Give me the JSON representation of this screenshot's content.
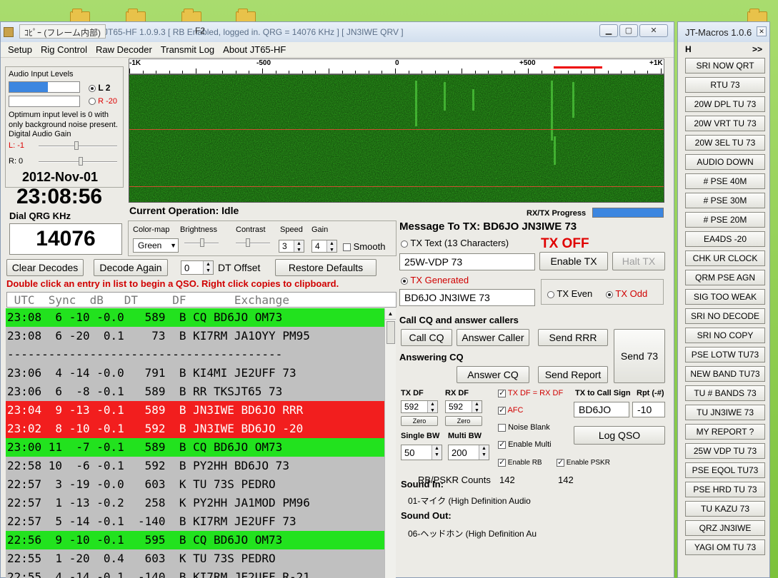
{
  "window": {
    "title": "JT65-HF 1.0.9.3  [ RB Enabled, logged in.  QRG = 14076 KHz ] [ JN3IWE QRV ]",
    "overlay_tab": "ｺﾋﾟｰ (フレーム内部)",
    "f2": "F2"
  },
  "menu": [
    "Setup",
    "Rig Control",
    "Raw Decoder",
    "Transmit Log",
    "About JT65-HF"
  ],
  "audio": {
    "label": "Audio Input Levels",
    "l_label": "L 2",
    "r_label": "R -20",
    "hint": "Optimum input level is 0 with only background noise present.",
    "gain_label": "Digital Audio Gain",
    "gain_l": "L: -1",
    "gain_r": "R: 0",
    "level_fraction_l": 0.55
  },
  "clock": {
    "date": "2012-Nov-01",
    "time": "23:08:56",
    "qrg_label": "Dial QRG KHz",
    "qrg": "14076"
  },
  "ruler": {
    "labels": [
      "-1K",
      "-500",
      "0",
      "+500",
      "+1K"
    ]
  },
  "operation": {
    "label": "Current Operation:",
    "value": "Idle"
  },
  "progress": {
    "label": "RX/TX Progress"
  },
  "controls": {
    "colormap_label": "Color-map",
    "colormap": "Green",
    "brightness_label": "Brightness",
    "contrast_label": "Contrast",
    "speed_label": "Speed",
    "speed": "3",
    "gain_label": "Gain",
    "gain": "4",
    "smooth_label": "Smooth"
  },
  "buttons": {
    "clear": "Clear Decodes",
    "decode_again": "Decode Again",
    "dt_value": "0",
    "dt_label": "DT Offset",
    "restore": "Restore Defaults"
  },
  "hint_red": "Double click an entry in list to begin a QSO.  Right click copies to clipboard.",
  "list_header": " UTC  Sync  dB   DT     DF       Exchange",
  "decodes": [
    {
      "text": "23:08  6 -10 -0.0   589  B CQ BD6JO OM73",
      "kind": "green"
    },
    {
      "text": "23:08  6 -20  0.1    73  B KI7RM JA1OYY PM95",
      "kind": ""
    },
    {
      "text": "----------------------------------------",
      "kind": "sep"
    },
    {
      "text": "23:06  4 -14 -0.0   791  B KI4MI JE2UFF 73",
      "kind": ""
    },
    {
      "text": "23:06  6  -8 -0.1   589  B RR TKSJT65 73",
      "kind": ""
    },
    {
      "text": "23:04  9 -13 -0.1   589  B JN3IWE BD6JO RRR",
      "kind": "red"
    },
    {
      "text": "23:02  8 -10 -0.1   592  B JN3IWE BD6JO -20",
      "kind": "red"
    },
    {
      "text": "23:00 11  -7 -0.1   589  B CQ BD6JO OM73",
      "kind": "green"
    },
    {
      "text": "22:58 10  -6 -0.1   592  B PY2HH BD6JO 73",
      "kind": ""
    },
    {
      "text": "22:57  3 -19 -0.0   603  K TU 73S PEDRO",
      "kind": ""
    },
    {
      "text": "22:57  1 -13 -0.2   258  K PY2HH JA1MOD PM96",
      "kind": ""
    },
    {
      "text": "22:57  5 -14 -0.1  -140  B KI7RM JE2UFF 73",
      "kind": ""
    },
    {
      "text": "22:56  9 -10 -0.1   595  B CQ BD6JO OM73",
      "kind": "green"
    },
    {
      "text": "22:55  1 -20  0.4   603  K TU 73S PEDRO",
      "kind": ""
    },
    {
      "text": "22:55  4 -14 -0.1  -140  B KI7RM JE2UFF R-21",
      "kind": ""
    }
  ],
  "tx": {
    "message_label": "Message To TX: BD6JO JN3IWE 73",
    "tx_text_label": "TX Text (13 Characters)",
    "tx_off": "TX OFF",
    "tx_text_value": "25W-VDP 73",
    "enable_tx": "Enable TX",
    "halt_tx": "Halt TX",
    "tx_generated_label": "TX Generated",
    "tx_generated_value": "BD6JO JN3IWE 73",
    "tx_even": "TX Even",
    "tx_odd": "TX Odd"
  },
  "qso": {
    "cq_label": "Call CQ and answer callers",
    "call_cq": "Call CQ",
    "answer_caller": "Answer Caller",
    "send_rrr": "Send RRR",
    "send_73": "Send 73",
    "answering_label": "Answering CQ",
    "answer_cq": "Answer CQ",
    "send_report": "Send Report"
  },
  "df": {
    "tx_df_label": "TX DF",
    "tx_df": "592",
    "rx_df_label": "RX DF",
    "rx_df": "592",
    "zero": "Zero",
    "single_bw_label": "Single BW",
    "single_bw": "50",
    "multi_bw_label": "Multi BW",
    "multi_bw": "200",
    "txdf_eq_rxdf": "TX DF = RX DF",
    "afc": "AFC",
    "noise_blank": "Noise Blank",
    "enable_multi": "Enable Multi",
    "enable_rb": "Enable RB",
    "enable_pskr": "Enable PSKR",
    "tx_call_label": "TX to Call Sign",
    "tx_call": "BD6JO",
    "rpt_label": "Rpt (-#)",
    "rpt": "-10",
    "log_qso": "Log QSO",
    "counts_label": "RB/PSKR Counts",
    "count_rb": "142",
    "count_pskr": "142"
  },
  "sound": {
    "in_label": "Sound In:",
    "in_value": "01-マイク (High Definition Audio",
    "out_label": "Sound Out:",
    "out_value": "06-ヘッドホン (High Definition Au"
  },
  "macros": {
    "title": "JT-Macros 1.0.6",
    "h": "H",
    "more": ">>",
    "items": [
      "SRI NOW QRT",
      "RTU 73",
      "20W DPL TU 73",
      "20W VRT TU 73",
      "20W 3EL TU 73",
      "AUDIO DOWN",
      "# PSE 40M",
      "# PSE 30M",
      "# PSE 20M",
      "EA4DS -20",
      "CHK UR CLOCK",
      "QRM PSE AGN",
      "SIG TOO WEAK",
      "SRI NO DECODE",
      "SRI NO COPY",
      "PSE LOTW TU73",
      "NEW BAND TU73",
      "TU # BANDS 73",
      "TU JN3IWE 73",
      "MY REPORT ?",
      "25W VDP TU 73",
      "PSE EQOL TU73",
      "PSE HRD TU 73",
      "TU KAZU 73",
      "QRZ JN3IWE",
      "YAGI OM TU 73"
    ]
  },
  "colors": {
    "green_row": "#22e21e",
    "red_row": "#f21e1e",
    "tx_off": "#e00000",
    "hint": "#d00000"
  }
}
